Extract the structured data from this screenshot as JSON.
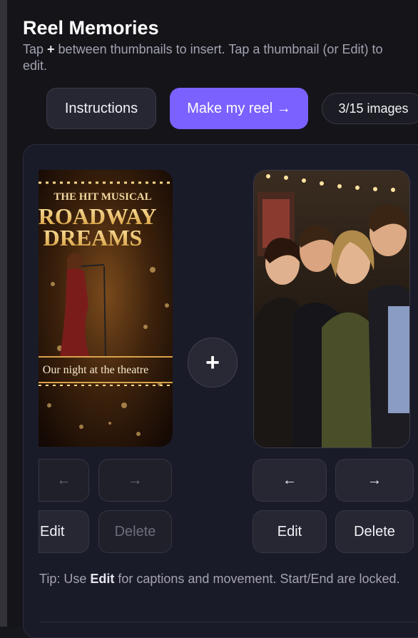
{
  "header": {
    "title": "Reel Memories",
    "subtitle_pre": "Tap ",
    "subtitle_plus": "+",
    "subtitle_post": " between thumbnails to insert. Tap a thumbnail (or Edit) to edit."
  },
  "actions": {
    "instructions_label": "Instructions",
    "make_reel_label": "Make my reel →",
    "count_label": "3/15 images"
  },
  "thumbnails": [
    {
      "poster_top": "THE HIT MUSICAL",
      "poster_line1": "BROADWAY",
      "poster_line2": "DREAMS",
      "poster_caption": "Our night at the theatre",
      "left_arrow": "←",
      "right_arrow": "→",
      "edit_label": "Edit",
      "delete_label": "Delete"
    },
    {
      "left_arrow": "←",
      "right_arrow": "→",
      "edit_label": "Edit",
      "delete_label": "Delete"
    }
  ],
  "insert": {
    "symbol": "+"
  },
  "tip": {
    "pre": "Tip: Use ",
    "bold": "Edit",
    "post": " for captions and movement. Start/End are locked."
  },
  "colors": {
    "accent": "#7b61ff",
    "background": "#141419",
    "card": "#1a1b28"
  }
}
